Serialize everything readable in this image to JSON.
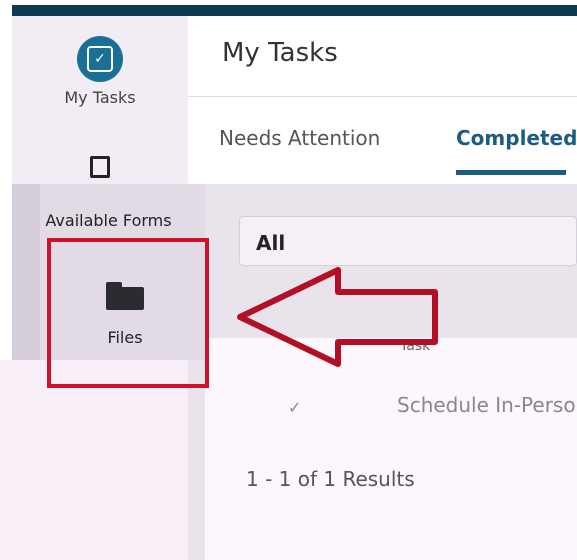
{
  "colors": {
    "topbar": "#0e3a56",
    "accent": "#1b5b84",
    "highlight": "#d0112b"
  },
  "sidebar": {
    "my_tasks_label": "My Tasks",
    "my_tasks_icon": "checkbox-icon",
    "available_forms_label": "Available Forms",
    "forms_icon": "document-icon",
    "files_label": "Files",
    "files_icon": "folder-icon"
  },
  "header": {
    "title": "My Tasks"
  },
  "tabs": [
    {
      "label": "Needs Attention"
    },
    {
      "label": "Completed",
      "active": true
    }
  ],
  "filter": {
    "value": "All"
  },
  "table": {
    "column_header": "Task",
    "rows": [
      {
        "icon": "check-icon",
        "text": "Schedule In-Person"
      }
    ]
  },
  "results_text": "1 - 1 of 1 Results",
  "annotation": {
    "type": "arrow",
    "points_to": "files"
  }
}
